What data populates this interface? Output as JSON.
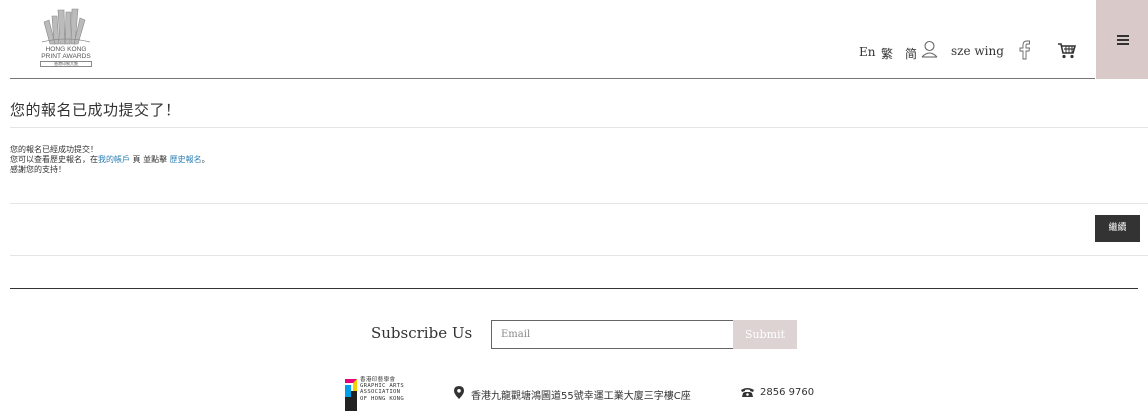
{
  "header": {
    "logo": {
      "line1": "HONG KONG",
      "line2": "PRINT AWARDS",
      "line3": "香港印制大奬"
    },
    "languages": [
      {
        "label": "En"
      },
      {
        "label": "繁"
      },
      {
        "label": "简"
      }
    ],
    "user": {
      "name": "sze wing",
      "icon": "user-icon"
    },
    "icons": {
      "facebook": "facebook-icon",
      "cart": "cart-icon",
      "menu": "hamburger-menu-icon"
    },
    "menu_bg": "#d9c9c9"
  },
  "main": {
    "title": "您的報名已成功提交了！",
    "message": {
      "line1": "您的報名已經成功提交！",
      "line2_prefix": "您可以查看歷史報名，在",
      "link_account": "我的帳戶",
      "line2_mid": " 頁 並點擊 ",
      "link_history": "歷史報名",
      "line2_suffix": "。",
      "line3": "感謝您的支持！"
    },
    "continue_label": "繼續"
  },
  "footer": {
    "subscribe_label": "Subscribe Us",
    "email_placeholder": "Email",
    "submit_label": "Submit",
    "gaa": {
      "line1": "香港印藝學會",
      "line2": "GRAPHIC ARTS",
      "line3": "ASSOCIATION",
      "line4": "OF HONG KONG"
    },
    "address": "香港九龍觀塘鴻圖道55號幸運工業大廈三字樓C座",
    "phone": "2856 9760"
  }
}
